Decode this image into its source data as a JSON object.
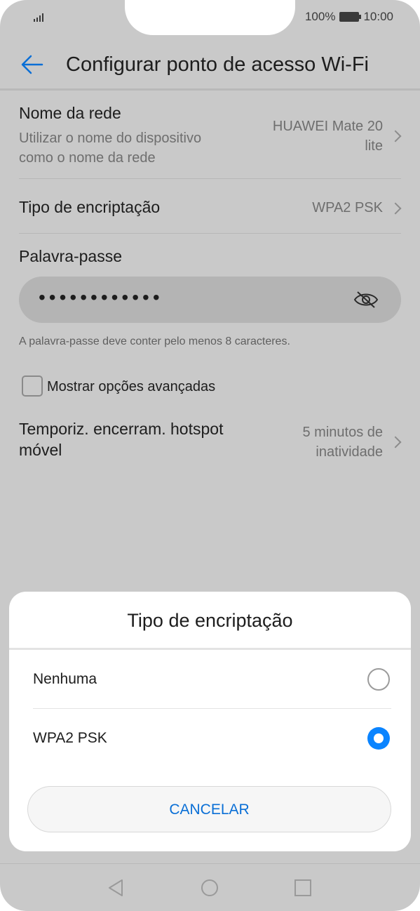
{
  "status_bar": {
    "battery": "100%",
    "time": "10:00"
  },
  "header": {
    "title": "Configurar ponto de acesso Wi-Fi"
  },
  "settings": {
    "network_name": {
      "label": "Nome da rede",
      "sub": "Utilizar o nome do dispositivo como o nome da rede",
      "value": "HUAWEI Mate 20 lite"
    },
    "encryption": {
      "label": "Tipo de encriptação",
      "value": "WPA2 PSK"
    },
    "password": {
      "label": "Palavra-passe",
      "value": "••••••••••••",
      "hint": "A palavra-passe deve conter pelo menos 8 caracteres."
    },
    "advanced": {
      "label": "Mostrar opções avançadas"
    },
    "timeout": {
      "label": "Temporiz. encerram. hotspot móvel",
      "value": "5 minutos de inatividade"
    }
  },
  "dialog": {
    "title": "Tipo de encriptação",
    "options": [
      {
        "label": "Nenhuma",
        "selected": false
      },
      {
        "label": "WPA2 PSK",
        "selected": true
      }
    ],
    "cancel_label": "CANCELAR"
  },
  "colors": {
    "accent": "#0a84ff",
    "cancel_text": "#0a6fd6"
  }
}
